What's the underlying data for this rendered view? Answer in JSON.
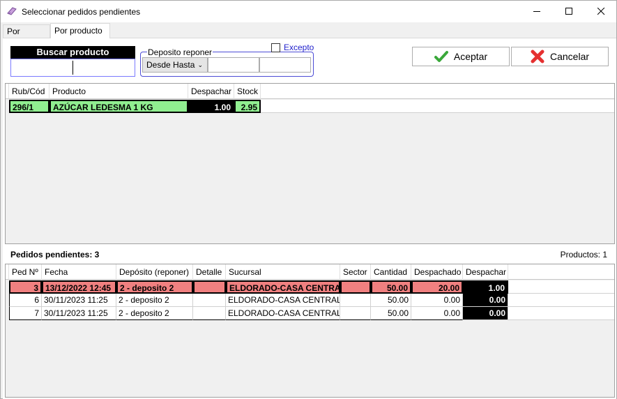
{
  "window": {
    "title": "Seleccionar pedidos pendientes"
  },
  "tabs": [
    {
      "label": "Por pedido"
    },
    {
      "label": "Por producto"
    }
  ],
  "search": {
    "label": "Buscar producto",
    "value": ""
  },
  "deposito": {
    "legend": "Deposito reponer",
    "excepto_label": "Excepto",
    "excepto_checked": false,
    "mode": "Desde Hasta",
    "desde": "",
    "hasta": ""
  },
  "actions": {
    "accept": "Aceptar",
    "cancel": "Cancelar"
  },
  "products": {
    "headers": [
      "Rub/Cód",
      "Producto",
      "Despachar",
      "Stock"
    ],
    "rows": [
      {
        "code": "296/1",
        "product": "AZÚCAR LEDESMA 1 KG",
        "despachar": "1.00",
        "stock": "2.95"
      }
    ]
  },
  "pending": {
    "label": "Pedidos pendientes: 3",
    "products_count": "Productos: 1",
    "headers": [
      "Ped Nº",
      "Fecha",
      "Depósito (reponer)",
      "Detalle",
      "Sucursal",
      "Sector",
      "Cantidad",
      "Despachado",
      "Despachar"
    ],
    "rows": [
      {
        "ped": "3",
        "fecha": "13/12/2022 12:45",
        "deposito": "2 - deposito 2",
        "detalle": "",
        "sucursal": "ELDORADO-CASA CENTRAL",
        "sector": "",
        "cantidad": "50.00",
        "despachado": "20.00",
        "despachar": "1.00"
      },
      {
        "ped": "6",
        "fecha": "30/11/2023 11:25",
        "deposito": "2 - deposito 2",
        "detalle": "",
        "sucursal": "ELDORADO-CASA CENTRAL",
        "sector": "",
        "cantidad": "50.00",
        "despachado": "0.00",
        "despachar": "0.00"
      },
      {
        "ped": "7",
        "fecha": "30/11/2023 11:25",
        "deposito": "2 - deposito 2",
        "detalle": "",
        "sucursal": "ELDORADO-CASA CENTRAL",
        "sector": "",
        "cantidad": "50.00",
        "despachado": "0.00",
        "despachar": "0.00"
      }
    ]
  },
  "colors": {
    "highlight_green": "#90ee90",
    "highlight_red": "#f08080",
    "black_cell": "#000000",
    "accent_blue": "#4b4bd6"
  }
}
